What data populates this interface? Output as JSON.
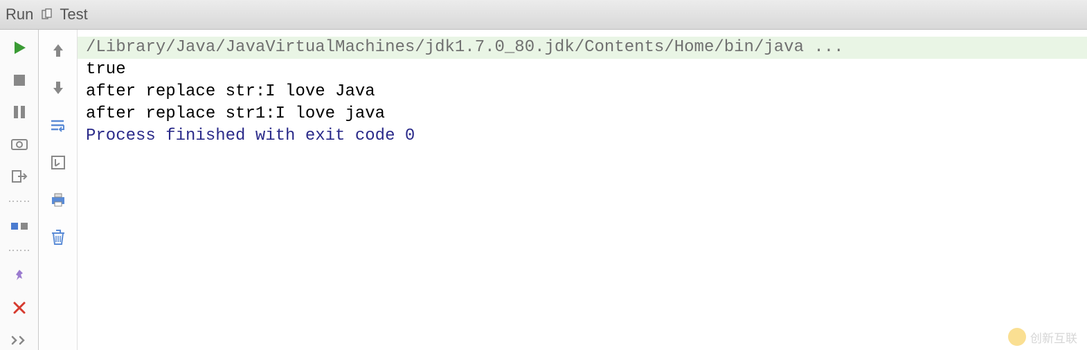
{
  "header": {
    "run_label": "Run",
    "config_name": "Test"
  },
  "console": {
    "command_line": "/Library/Java/JavaVirtualMachines/jdk1.7.0_80.jdk/Contents/Home/bin/java ...",
    "lines": [
      "true",
      "after replace str:I love Java",
      "after replace str1:I love java",
      ""
    ],
    "exit_line": "Process finished with exit code 0"
  },
  "watermark": {
    "text": "创新互联"
  }
}
